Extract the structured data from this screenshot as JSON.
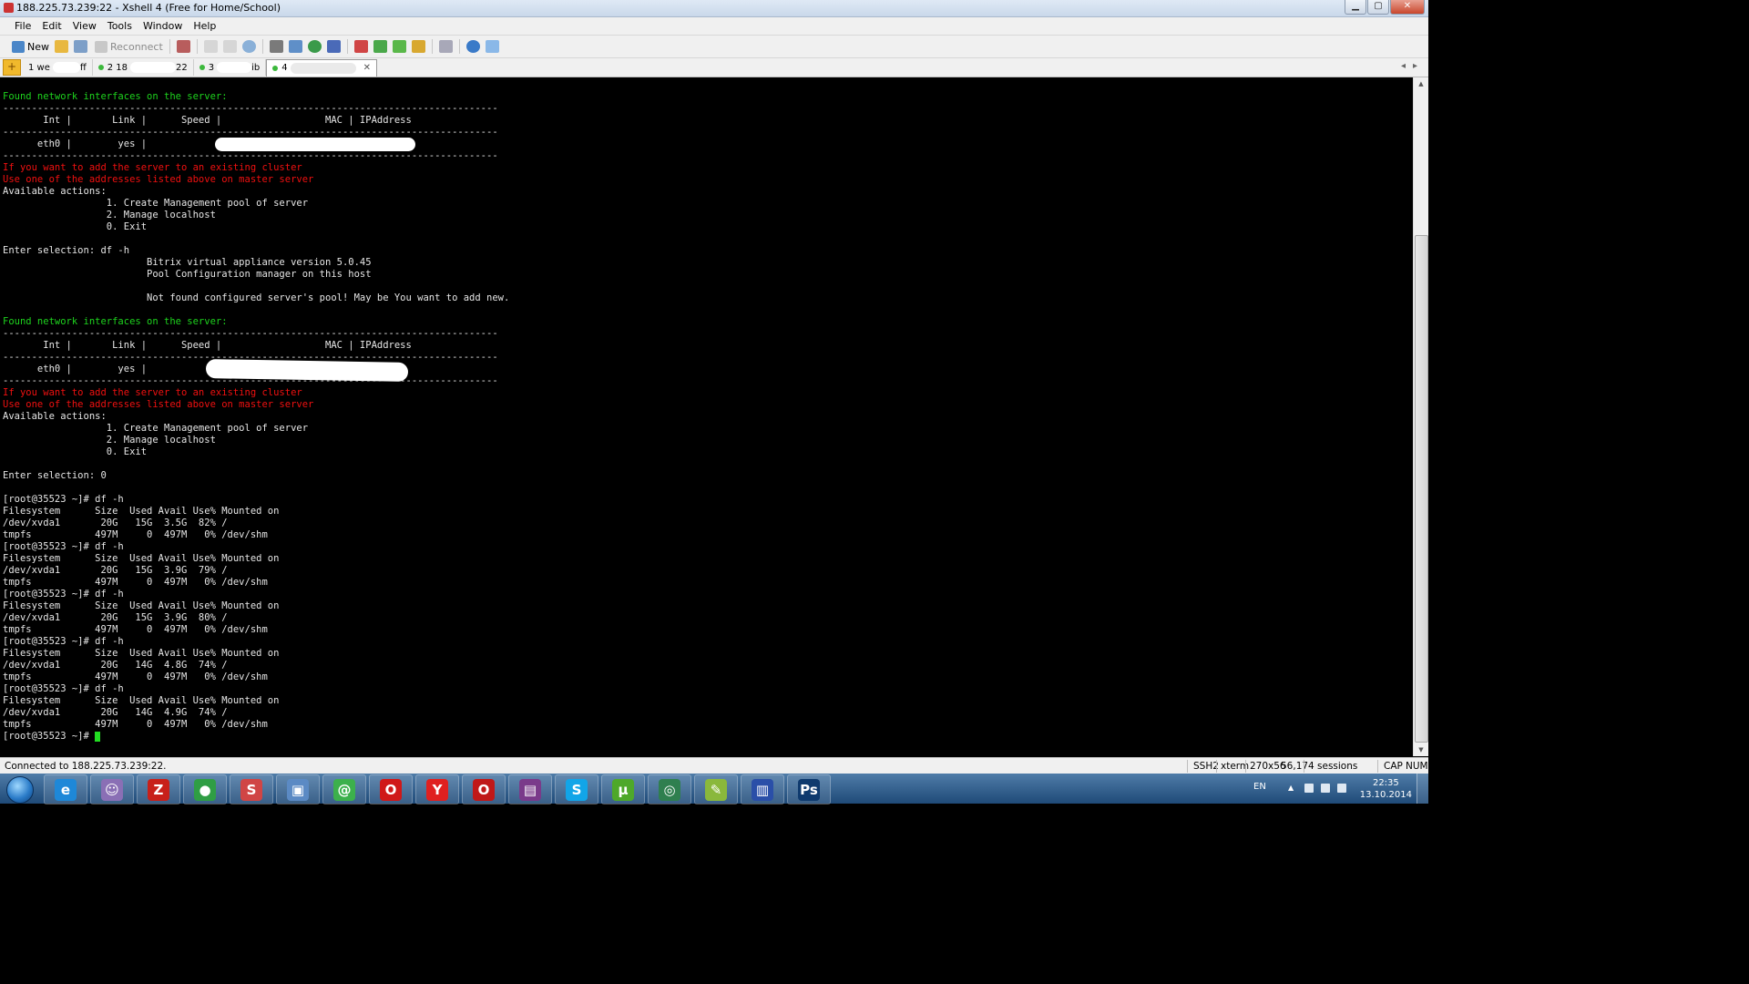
{
  "window": {
    "title": "188.225.73.239:22 - Xshell 4 (Free for Home/School)",
    "controls": [
      "minimize",
      "maximize",
      "close"
    ]
  },
  "menu": [
    "File",
    "Edit",
    "View",
    "Tools",
    "Window",
    "Help"
  ],
  "toolbar": {
    "new_label": "New",
    "reconnect_label": "Reconnect",
    "icons": [
      "new-session-icon",
      "open-folder-icon",
      "reconnect-icon",
      "properties-icon",
      "copy-icon",
      "paste-icon",
      "find-icon",
      "print-icon",
      "transfer-icon",
      "globe-icon",
      "font-icon",
      "xftp-icon",
      "compose-icon",
      "layout-icon",
      "lock-icon",
      "keyboard-icon",
      "help-icon",
      "chat-icon"
    ]
  },
  "tabs": [
    {
      "label": "1 we",
      "tail": "ff",
      "active": false
    },
    {
      "label": "2 18",
      "tail": "22",
      "active": false
    },
    {
      "label": "3",
      "tail": "ib",
      "active": false
    },
    {
      "label": "4",
      "tail": "",
      "active": true
    }
  ],
  "terminal": {
    "lines": [
      {
        "text": "Found network interfaces on the server:",
        "color": "green"
      },
      {
        "text": "--------------------------------------------------------------------------------------",
        "color": "default"
      },
      {
        "text": "       Int |       Link |      Speed |                  MAC | IPAddress",
        "color": "default"
      },
      {
        "text": "--------------------------------------------------------------------------------------",
        "color": "default"
      },
      {
        "text": "      eth0 |        yes |            |",
        "color": "default"
      },
      {
        "text": "--------------------------------------------------------------------------------------",
        "color": "default"
      },
      {
        "text": "If you want to add the server to an existing cluster",
        "color": "red"
      },
      {
        "text": "Use one of the addresses listed above on master server",
        "color": "red"
      },
      {
        "text": "Available actions:",
        "color": "default"
      },
      {
        "text": "                  1. Create Management pool of server",
        "color": "default"
      },
      {
        "text": "                  2. Manage localhost",
        "color": "default"
      },
      {
        "text": "                  0. Exit",
        "color": "default"
      },
      {
        "text": "",
        "color": "default"
      },
      {
        "text": "Enter selection: df -h",
        "color": "default"
      },
      {
        "text": "                         Bitrix virtual appliance version 5.0.45",
        "color": "default"
      },
      {
        "text": "                         Pool Configuration manager on this host",
        "color": "default"
      },
      {
        "text": "",
        "color": "default"
      },
      {
        "text": "                         Not found configured server's pool! May be You want to add new.",
        "color": "default"
      },
      {
        "text": "",
        "color": "default"
      },
      {
        "text": "Found network interfaces on the server:",
        "color": "green"
      },
      {
        "text": "--------------------------------------------------------------------------------------",
        "color": "default"
      },
      {
        "text": "       Int |       Link |      Speed |                  MAC | IPAddress",
        "color": "default"
      },
      {
        "text": "--------------------------------------------------------------------------------------",
        "color": "default"
      },
      {
        "text": "      eth0 |        yes |            |",
        "color": "default"
      },
      {
        "text": "--------------------------------------------------------------------------------------",
        "color": "default"
      },
      {
        "text": "If you want to add the server to an existing cluster",
        "color": "red"
      },
      {
        "text": "Use one of the addresses listed above on master server",
        "color": "red"
      },
      {
        "text": "Available actions:",
        "color": "default"
      },
      {
        "text": "                  1. Create Management pool of server",
        "color": "default"
      },
      {
        "text": "                  2. Manage localhost",
        "color": "default"
      },
      {
        "text": "                  0. Exit",
        "color": "default"
      },
      {
        "text": "",
        "color": "default"
      },
      {
        "text": "Enter selection: 0",
        "color": "default"
      },
      {
        "text": "",
        "color": "default"
      },
      {
        "text": "[root@35523 ~]# df -h",
        "color": "default"
      },
      {
        "text": "Filesystem      Size  Used Avail Use% Mounted on",
        "color": "default"
      },
      {
        "text": "/dev/xvda1       20G   15G  3.5G  82% /",
        "color": "default"
      },
      {
        "text": "tmpfs           497M     0  497M   0% /dev/shm",
        "color": "default"
      },
      {
        "text": "[root@35523 ~]# df -h",
        "color": "default"
      },
      {
        "text": "Filesystem      Size  Used Avail Use% Mounted on",
        "color": "default"
      },
      {
        "text": "/dev/xvda1       20G   15G  3.9G  79% /",
        "color": "default"
      },
      {
        "text": "tmpfs           497M     0  497M   0% /dev/shm",
        "color": "default"
      },
      {
        "text": "[root@35523 ~]# df -h",
        "color": "default"
      },
      {
        "text": "Filesystem      Size  Used Avail Use% Mounted on",
        "color": "default"
      },
      {
        "text": "/dev/xvda1       20G   15G  3.9G  80% /",
        "color": "default"
      },
      {
        "text": "tmpfs           497M     0  497M   0% /dev/shm",
        "color": "default"
      },
      {
        "text": "[root@35523 ~]# df -h",
        "color": "default"
      },
      {
        "text": "Filesystem      Size  Used Avail Use% Mounted on",
        "color": "default"
      },
      {
        "text": "/dev/xvda1       20G   14G  4.8G  74% /",
        "color": "default"
      },
      {
        "text": "tmpfs           497M     0  497M   0% /dev/shm",
        "color": "default"
      },
      {
        "text": "[root@35523 ~]# df -h",
        "color": "default"
      },
      {
        "text": "Filesystem      Size  Used Avail Use% Mounted on",
        "color": "default"
      },
      {
        "text": "/dev/xvda1       20G   14G  4.9G  74% /",
        "color": "default"
      },
      {
        "text": "tmpfs           497M     0  497M   0% /dev/shm",
        "color": "default"
      },
      {
        "text": "[root@35523 ~]# ",
        "color": "default"
      }
    ],
    "colors": {
      "default": "#e6e6e6",
      "green": "#1ed41e",
      "red": "#f01010",
      "cursor": "#22dd22"
    }
  },
  "status": {
    "connection": "Connected to 188.225.73.239:22.",
    "protocol": "SSH2",
    "term": "xterm",
    "size": "270x56",
    "position": "56,17",
    "sessions": "4 sessions",
    "cap": "CAP",
    "num": "NUM"
  },
  "taskbar": {
    "apps": [
      {
        "name": "internet-explorer",
        "glyph": "e",
        "color": "#1e88d8"
      },
      {
        "name": "pidgin",
        "glyph": "☺",
        "color": "#8a6fb5"
      },
      {
        "name": "filezilla",
        "glyph": "Z",
        "color": "#c8201a"
      },
      {
        "name": "chrome",
        "glyph": "●",
        "color": "#2f9e44"
      },
      {
        "name": "xshell",
        "glyph": "S",
        "color": "#d04545"
      },
      {
        "name": "network-tool",
        "glyph": "▣",
        "color": "#5b8ac4"
      },
      {
        "name": "icq",
        "glyph": "@",
        "color": "#3cb04c"
      },
      {
        "name": "opera",
        "glyph": "O",
        "color": "#d01818"
      },
      {
        "name": "yandex-browser",
        "glyph": "Y",
        "color": "#e02020"
      },
      {
        "name": "opera-next",
        "glyph": "O",
        "color": "#c01818"
      },
      {
        "name": "winrar",
        "glyph": "▤",
        "color": "#7a3a8a"
      },
      {
        "name": "skype",
        "glyph": "S",
        "color": "#12a5e8"
      },
      {
        "name": "utorrent",
        "glyph": "µ",
        "color": "#4ea82a"
      },
      {
        "name": "teamviewer",
        "glyph": "◎",
        "color": "#2f7f4f"
      },
      {
        "name": "notepad",
        "glyph": "✎",
        "color": "#8ab83c"
      },
      {
        "name": "floppy-save",
        "glyph": "▥",
        "color": "#2a4fa8"
      },
      {
        "name": "photoshop",
        "glyph": "Ps",
        "color": "#0f3a6e"
      }
    ],
    "lang": "EN",
    "time": "22:35",
    "date": "13.10.2014"
  }
}
